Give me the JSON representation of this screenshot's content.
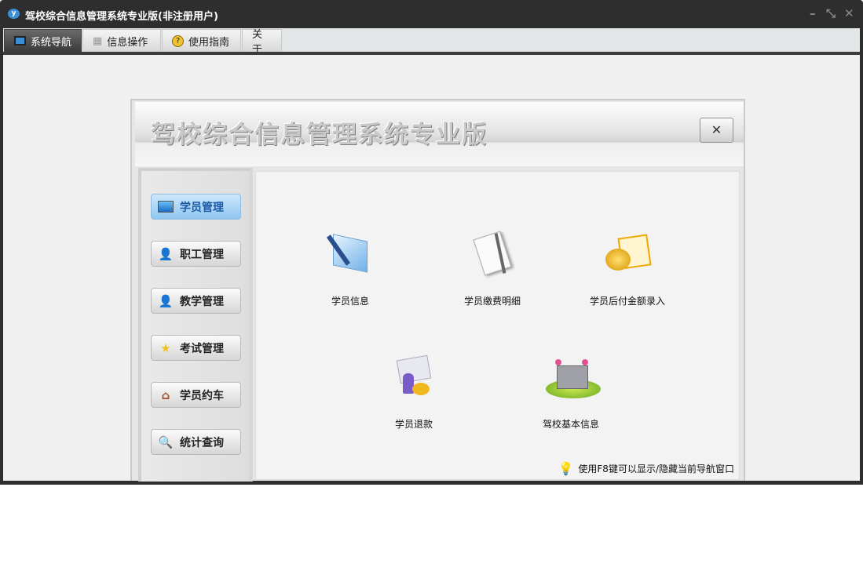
{
  "window": {
    "title": "驾校综合信息管理系统专业版(非注册用户)",
    "controls": {
      "minimize": "–",
      "restore": "⤡",
      "close": "✕"
    }
  },
  "tabs": [
    {
      "label": "系统导航",
      "icon": "monitor-icon"
    },
    {
      "label": "信息操作",
      "icon": "grid-icon"
    },
    {
      "label": "使用指南",
      "icon": "help-icon"
    },
    {
      "label": "关于"
    }
  ],
  "panel": {
    "title": "驾校综合信息管理系统专业版",
    "close": "✕"
  },
  "sidebar": [
    {
      "label": "学员管理",
      "icon": "monitor-icon"
    },
    {
      "label": "职工管理",
      "icon": "person-icon"
    },
    {
      "label": "教学管理",
      "icon": "teacher-icon"
    },
    {
      "label": "考试管理",
      "icon": "star-icon"
    },
    {
      "label": "学员约车",
      "icon": "home-icon"
    },
    {
      "label": "统计查询",
      "icon": "search-icon"
    }
  ],
  "items": [
    {
      "label": "学员信息"
    },
    {
      "label": "学员缴费明细"
    },
    {
      "label": "学员后付金额录入"
    },
    {
      "label": "学员退款"
    },
    {
      "label": "驾校基本信息"
    }
  ],
  "tip": "使用F8键可以显示/隐藏当前导航窗口"
}
